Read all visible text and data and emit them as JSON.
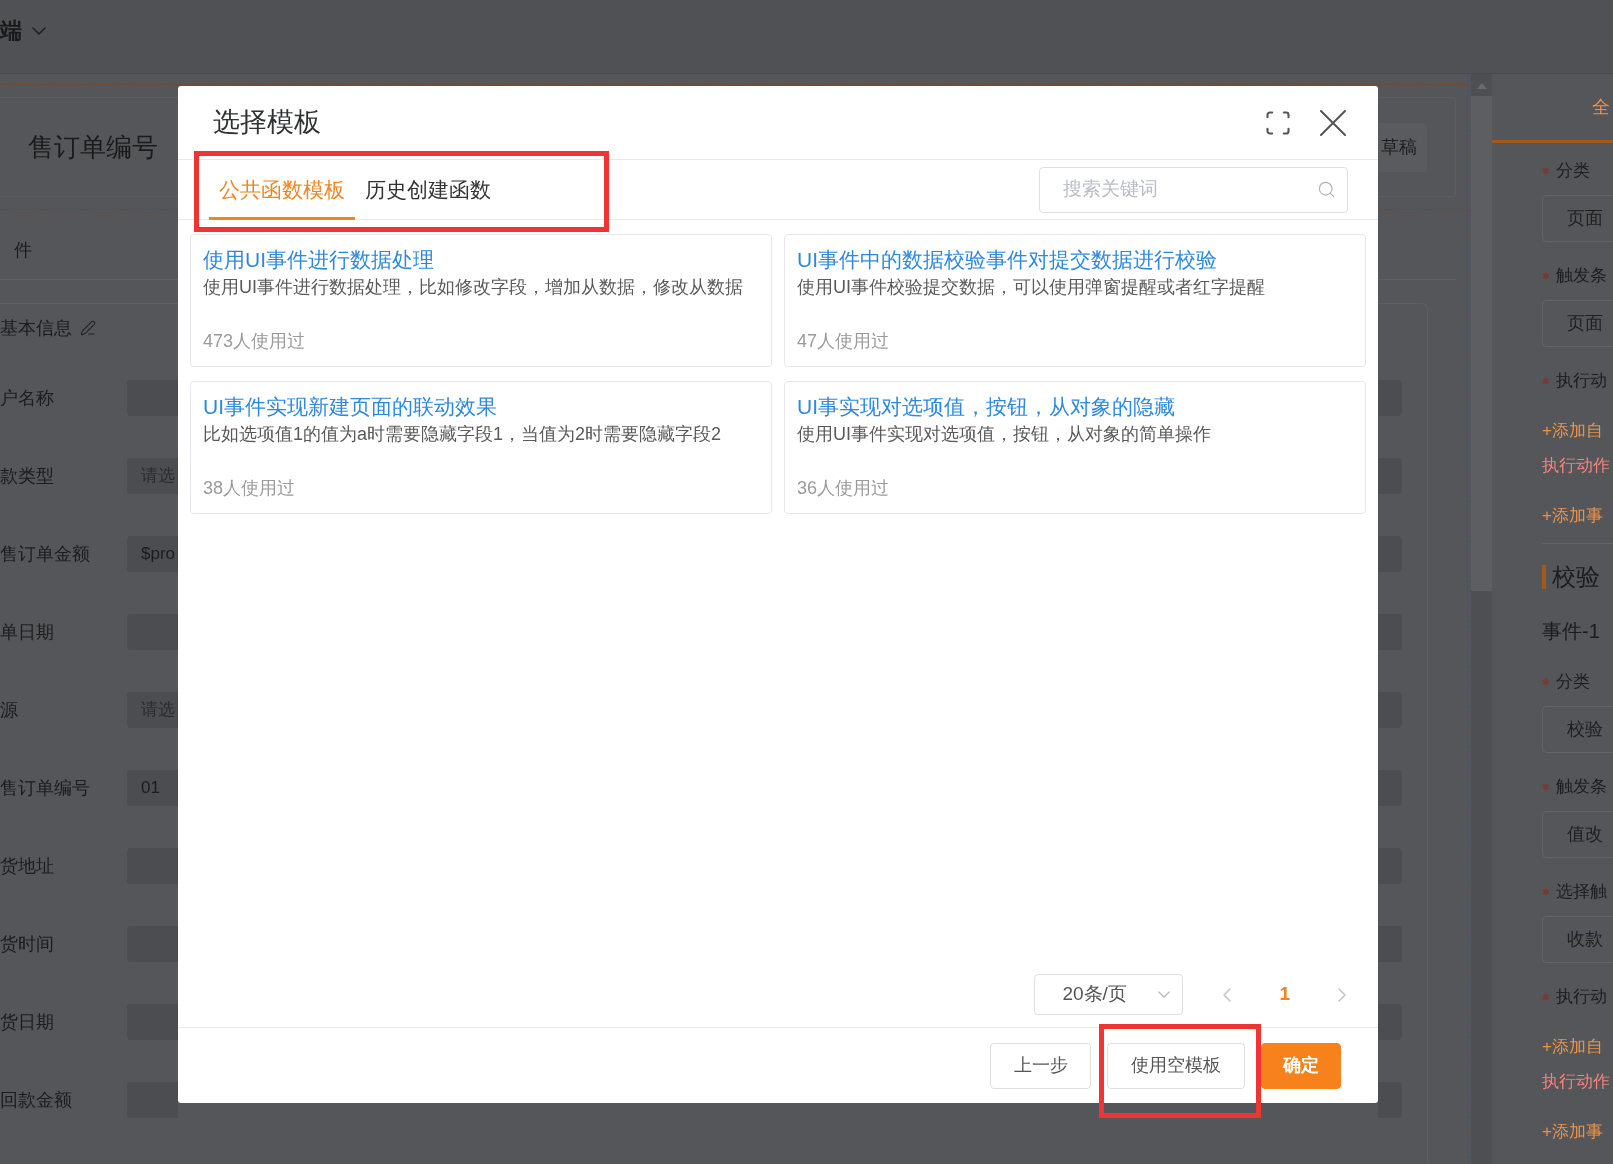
{
  "app_header": {
    "title": "端"
  },
  "form_header": {
    "title": "售订单编号",
    "draft_button": "草稿"
  },
  "form": {
    "tab": "件",
    "section_title": "基本信息",
    "fields": [
      {
        "label": "户名称"
      },
      {
        "label": "款类型",
        "placeholder": "请选"
      },
      {
        "label": "售订单金额",
        "value": "$pro"
      },
      {
        "label": "单日期"
      },
      {
        "label": "源",
        "placeholder": "请选"
      },
      {
        "label": "售订单编号",
        "value": "01"
      },
      {
        "label": "货地址"
      },
      {
        "label": "货时间"
      },
      {
        "label": "货日期"
      },
      {
        "label": "回款金额"
      }
    ]
  },
  "right_panel": {
    "tabs": [
      {
        "label": "全",
        "selected": true
      }
    ],
    "items": [
      {
        "kind": "label",
        "text": "分类",
        "required": true
      },
      {
        "kind": "select",
        "value": "页面"
      },
      {
        "kind": "label",
        "text": "触发条",
        "required": true
      },
      {
        "kind": "select",
        "value": "页面"
      },
      {
        "kind": "label",
        "text": "执行动",
        "required": true
      },
      {
        "kind": "link",
        "text": "+添加自"
      },
      {
        "kind": "error",
        "text": "执行动作"
      },
      {
        "kind": "link",
        "text": "+添加事"
      },
      {
        "kind": "heading",
        "text": "校验"
      },
      {
        "kind": "subheading",
        "text": "事件-1"
      },
      {
        "kind": "label",
        "text": "分类",
        "required": true
      },
      {
        "kind": "select",
        "value": "校验"
      },
      {
        "kind": "label",
        "text": "触发条",
        "required": true
      },
      {
        "kind": "select",
        "value": "值改"
      },
      {
        "kind": "label",
        "text": "选择触",
        "required": true
      },
      {
        "kind": "select",
        "value": "收款"
      },
      {
        "kind": "label",
        "text": "执行动",
        "required": true
      },
      {
        "kind": "link",
        "text": "+添加自"
      },
      {
        "kind": "error",
        "text": "执行动作"
      },
      {
        "kind": "link",
        "text": "+添加事"
      }
    ]
  },
  "dialog": {
    "title": "选择模板",
    "tabs": [
      {
        "label": "公共函数模板",
        "selected": true
      },
      {
        "label": "历史创建函数",
        "selected": false
      }
    ],
    "tabs_highlighted": true,
    "search": {
      "placeholder": "搜索关键词"
    },
    "templates": [
      {
        "title": "使用UI事件进行数据处理",
        "description": "使用UI事件进行数据处理，比如修改字段，增加从数据，修改从数据",
        "usage": "473人使用过"
      },
      {
        "title": "UI事件中的数据校验事件对提交数据进行校验",
        "description": "使用UI事件校验提交数据，可以使用弹窗提醒或者红字提醒",
        "usage": "47人使用过"
      },
      {
        "title": "UI事件实现新建页面的联动效果",
        "description": "比如选项值1的值为a时需要隐藏字段1，当值为2时需要隐藏字段2",
        "usage": "38人使用过"
      },
      {
        "title": "UI事实现对选项值，按钮，从对象的隐藏",
        "description": "使用UI事件实现对选项值，按钮，从对象的简单操作",
        "usage": "36人使用过"
      }
    ],
    "pagination": {
      "page_size": "20条/页",
      "previous": {
        "disabled": true
      },
      "pages": [
        {
          "label": "1",
          "selected": true
        }
      ],
      "next": {
        "disabled": true
      }
    },
    "buttons": [
      {
        "label": "上一步",
        "kind": "default",
        "highlighted": false
      },
      {
        "label": "使用空模板",
        "kind": "default",
        "highlighted": true
      },
      {
        "label": "确定",
        "kind": "primary",
        "highlighted": false
      }
    ]
  }
}
